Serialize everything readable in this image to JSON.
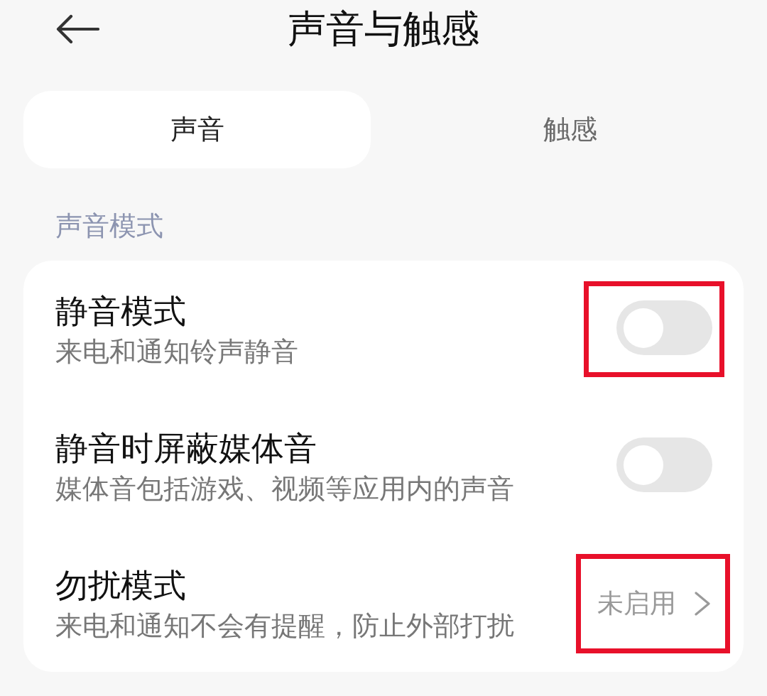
{
  "header": {
    "title": "声音与触感"
  },
  "tabs": [
    {
      "label": "声音",
      "selected": true
    },
    {
      "label": "触感",
      "selected": false
    }
  ],
  "section": {
    "title": "声音模式"
  },
  "rows": [
    {
      "kind": "toggle",
      "title": "静音模式",
      "subtitle": "来电和通知铃声静音",
      "on": false,
      "highlighted": true
    },
    {
      "kind": "toggle",
      "title": "静音时屏蔽媒体音",
      "subtitle": "媒体音包括游戏、视频等应用内的声音",
      "on": false,
      "highlighted": false
    },
    {
      "kind": "link",
      "title": "勿扰模式",
      "subtitle": "来电和通知不会有提醒，防止外部打扰",
      "value": "未启用",
      "highlighted": true
    }
  ]
}
